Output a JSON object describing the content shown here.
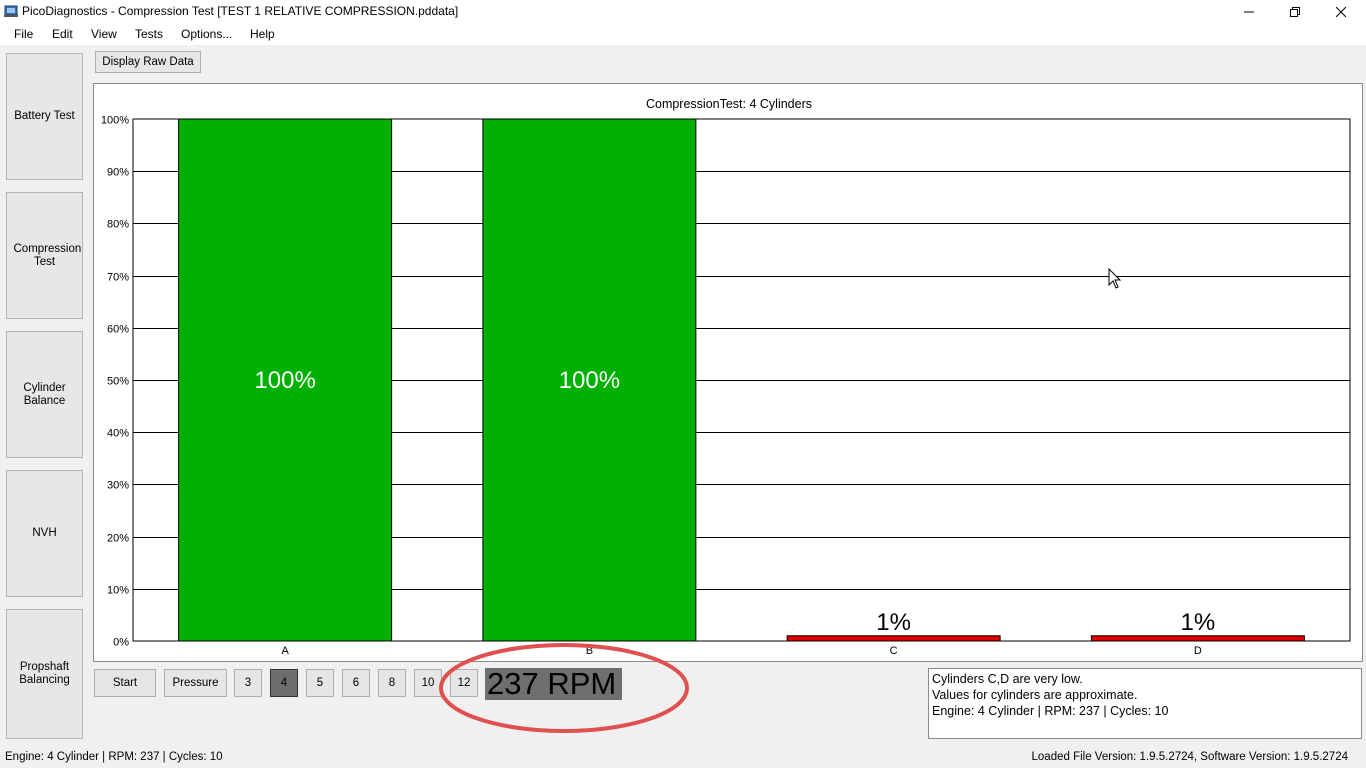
{
  "window": {
    "title": "PicoDiagnostics - Compression Test [TEST 1 RELATIVE COMPRESSION.pddata]"
  },
  "menu": [
    "File",
    "Edit",
    "View",
    "Tests",
    "Options...",
    "Help"
  ],
  "sidebar": [
    {
      "label": "Battery Test"
    },
    {
      "label": "Compression Test"
    },
    {
      "label": "Cylinder Balance"
    },
    {
      "label": "NVH"
    },
    {
      "label": "Propshaft Balancing"
    }
  ],
  "toolbar": {
    "raw_data_label": "Display Raw Data"
  },
  "chart_data": {
    "type": "bar",
    "title": "CompressionTest: 4 Cylinders",
    "categories": [
      "A",
      "B",
      "C",
      "D"
    ],
    "values": [
      100,
      100,
      1,
      1
    ],
    "value_labels": [
      "100%",
      "100%",
      "1%",
      "1%"
    ],
    "bar_colors": [
      "#00b000",
      "#00b000",
      "#e00000",
      "#e00000"
    ],
    "ylim": [
      0,
      100
    ],
    "yticks": [
      "0%",
      "10%",
      "20%",
      "30%",
      "40%",
      "50%",
      "60%",
      "70%",
      "80%",
      "90%",
      "100%"
    ],
    "grid": true
  },
  "controls": {
    "start_label": "Start",
    "pressure_label": "Pressure",
    "cylinder_options": [
      "3",
      "4",
      "5",
      "6",
      "8",
      "10",
      "12"
    ],
    "selected_cylinders": "4",
    "rpm_display": "237 RPM"
  },
  "messages": [
    "Cylinders C,D are very low.",
    "Values for cylinders are approximate.",
    "Engine: 4 Cylinder | RPM: 237 | Cycles: 10"
  ],
  "status": {
    "left": "Engine: 4 Cylinder | RPM: 237 | Cycles: 10",
    "right": "Loaded File Version: 1.9.5.2724,  Software Version: 1.9.5.2724"
  },
  "colors": {
    "highlight_ellipse": "#e05050",
    "selected_button": "#6e6e6e"
  }
}
